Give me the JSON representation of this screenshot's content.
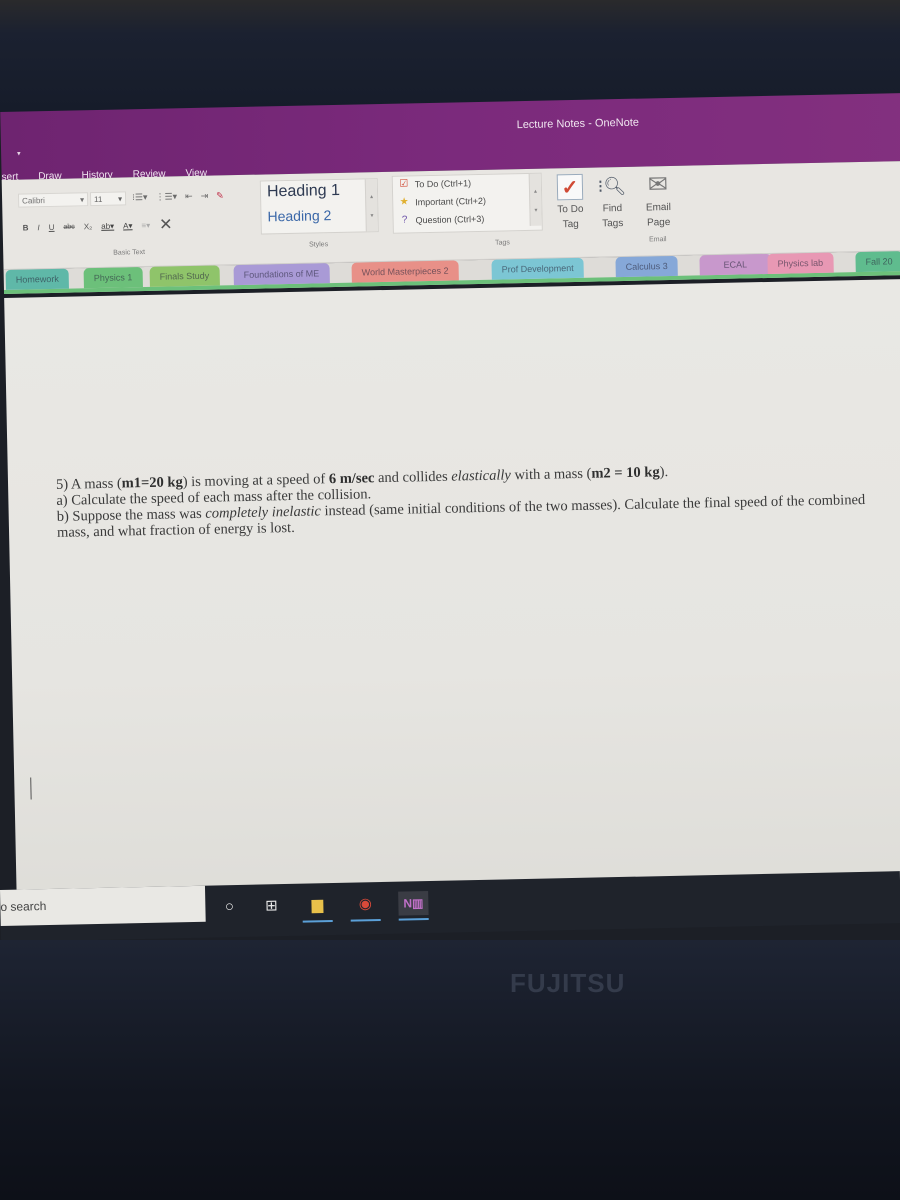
{
  "window": {
    "title": "Lecture Notes",
    "separator": "-",
    "app_name": "OneNote"
  },
  "ribbon_tabs": [
    "sert",
    "Draw",
    "History",
    "Review",
    "View"
  ],
  "basic_text": {
    "font_name": "Calibri",
    "font_size": "11",
    "buttons": [
      "B",
      "I",
      "U",
      "abc",
      "X₂"
    ],
    "group_label": "Basic Text"
  },
  "styles": {
    "heading1": "Heading 1",
    "heading2": "Heading 2",
    "group_label": "Styles"
  },
  "tags": {
    "items": [
      {
        "icon": "checkbox-icon",
        "glyph": "☑",
        "label": "To Do (Ctrl+1)"
      },
      {
        "icon": "star-icon",
        "glyph": "★",
        "label": "Important (Ctrl+2)"
      },
      {
        "icon": "question-icon",
        "glyph": "?",
        "label": "Question (Ctrl+3)"
      }
    ],
    "todo_tag_line1": "To Do",
    "todo_tag_line2": "Tag",
    "find_tags_line1": "Find",
    "find_tags_line2": "Tags",
    "group_label": "Tags"
  },
  "email": {
    "line1": "Email",
    "line2": "Page",
    "group_label": "Email"
  },
  "notebook_tabs": [
    {
      "label": "Homework",
      "color": "#5fb8a8"
    },
    {
      "label": "Physics 1",
      "color": "#6cc07a"
    },
    {
      "label": "Finals Study",
      "color": "#8fc46a"
    },
    {
      "label": "Foundations of ME",
      "color": "#a99ad6"
    },
    {
      "label": "World Masterpieces 2",
      "color": "#e89088"
    },
    {
      "label": "Prof Development",
      "color": "#7cc6d4"
    },
    {
      "label": "Calculus 3",
      "color": "#86a8d8"
    },
    {
      "label": "ECAL",
      "color": "#c898cc"
    },
    {
      "label": "Physics lab",
      "color": "#e898b4"
    },
    {
      "label": "Fall 20",
      "color": "#5fbc8e"
    }
  ],
  "page_content": {
    "line1_a": "5) A mass (",
    "line1_b": "m1=20 kg",
    "line1_c": ") is moving at a speed of ",
    "line1_d": "6 m/sec",
    "line1_e": " and collides ",
    "line1_f": "elastically",
    "line1_g": " with a mass (",
    "line1_h": "m2 = 10 kg",
    "line1_i": ").",
    "line2": "a) Calculate the speed of each mass after the collision.",
    "line3_a": "b) Suppose the mass was ",
    "line3_b": "completely inelastic",
    "line3_c": " instead (same initial conditions of the two masses). Calculate the final speed of the combined mass, and what fraction of energy is lost."
  },
  "taskbar": {
    "search_text": "o search",
    "icons": [
      "cortana-icon",
      "task-view-icon",
      "file-explorer-icon",
      "chrome-icon",
      "onenote-icon"
    ]
  },
  "bezel_brand": "FUJITSU",
  "colors": {
    "onenote_purple": "#7b2a7c",
    "ribbon_bg": "#e8e6e2",
    "tab_bar_accent": "#6cc07a"
  }
}
